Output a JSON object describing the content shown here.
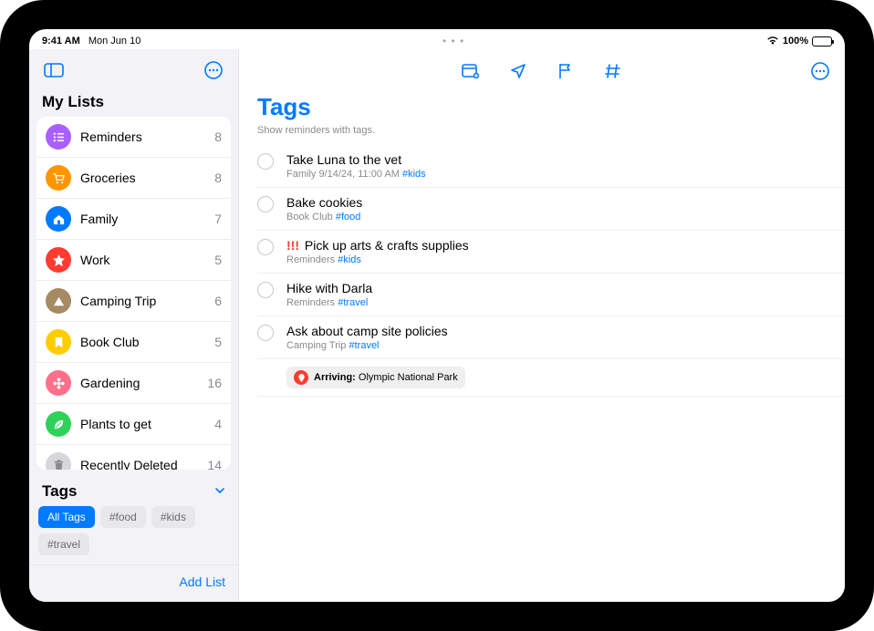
{
  "status": {
    "time": "9:41 AM",
    "date": "Mon Jun 10",
    "dots": "• • •",
    "battery_pct": "100%",
    "battery_level": 100
  },
  "sidebar": {
    "section_title": "My Lists",
    "lists": [
      {
        "name": "Reminders",
        "count": "8",
        "color": "#a960ff",
        "icon": "list"
      },
      {
        "name": "Groceries",
        "count": "8",
        "color": "#ff9500",
        "icon": "cart"
      },
      {
        "name": "Family",
        "count": "7",
        "color": "#007aff",
        "icon": "house"
      },
      {
        "name": "Work",
        "count": "5",
        "color": "#ff3b30",
        "icon": "star"
      },
      {
        "name": "Camping Trip",
        "count": "6",
        "color": "#a58a63",
        "icon": "tent"
      },
      {
        "name": "Book Club",
        "count": "5",
        "color": "#ffcc00",
        "icon": "bookmark"
      },
      {
        "name": "Gardening",
        "count": "16",
        "color": "#ff6f8a",
        "icon": "flower"
      },
      {
        "name": "Plants to get",
        "count": "4",
        "color": "#30d158",
        "icon": "leaf"
      },
      {
        "name": "Recently Deleted",
        "count": "14",
        "color": "#d7d7db",
        "icon": "trash"
      }
    ],
    "tags_title": "Tags",
    "tags": [
      {
        "label": "All Tags",
        "active": true
      },
      {
        "label": "#food",
        "active": false
      },
      {
        "label": "#kids",
        "active": false
      },
      {
        "label": "#travel",
        "active": false
      }
    ],
    "add_list": "Add List"
  },
  "content": {
    "title": "Tags",
    "subtitle": "Show reminders with tags.",
    "reminders": [
      {
        "title": "Take Luna to the vet",
        "meta_prefix": "Family  9/14/24, 11:00 AM",
        "tag": "#kids",
        "priority": ""
      },
      {
        "title": "Bake cookies",
        "meta_prefix": "Book Club",
        "tag": "#food",
        "priority": ""
      },
      {
        "title": "Pick up arts & crafts supplies",
        "meta_prefix": "Reminders",
        "tag": "#kids",
        "priority": "!!!"
      },
      {
        "title": "Hike with Darla",
        "meta_prefix": "Reminders",
        "tag": "#travel",
        "priority": ""
      },
      {
        "title": "Ask about camp site policies",
        "meta_prefix": "Camping Trip",
        "tag": "#travel",
        "priority": "",
        "location_prefix": "Arriving:",
        "location_value": "Olympic National Park"
      }
    ]
  }
}
